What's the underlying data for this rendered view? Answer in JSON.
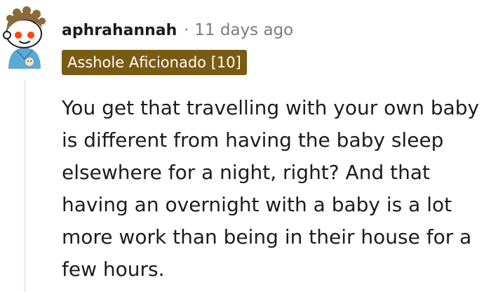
{
  "comment": {
    "username": "aphrahannah",
    "separator": "·",
    "timestamp": "11 days ago",
    "flair": "Asshole Aficionado [10]",
    "body": "You get that travelling with your own baby is different from having the baby sleep elsewhere for a night, right? And that having an overnight with a baby is a lot more work than being in their house for a few hours."
  },
  "avatar": {
    "icon": "snoo-avatar-icon",
    "colors": {
      "background": "#5fa8d3",
      "head": "#ffffff",
      "eyes": "#ff4500",
      "hair": "#8a6a3b"
    }
  },
  "colors": {
    "flair_background": "#7a5b14",
    "flair_text": "#ffffff",
    "meta_text": "#7c7c7c",
    "thread_line": "#edeff1"
  }
}
